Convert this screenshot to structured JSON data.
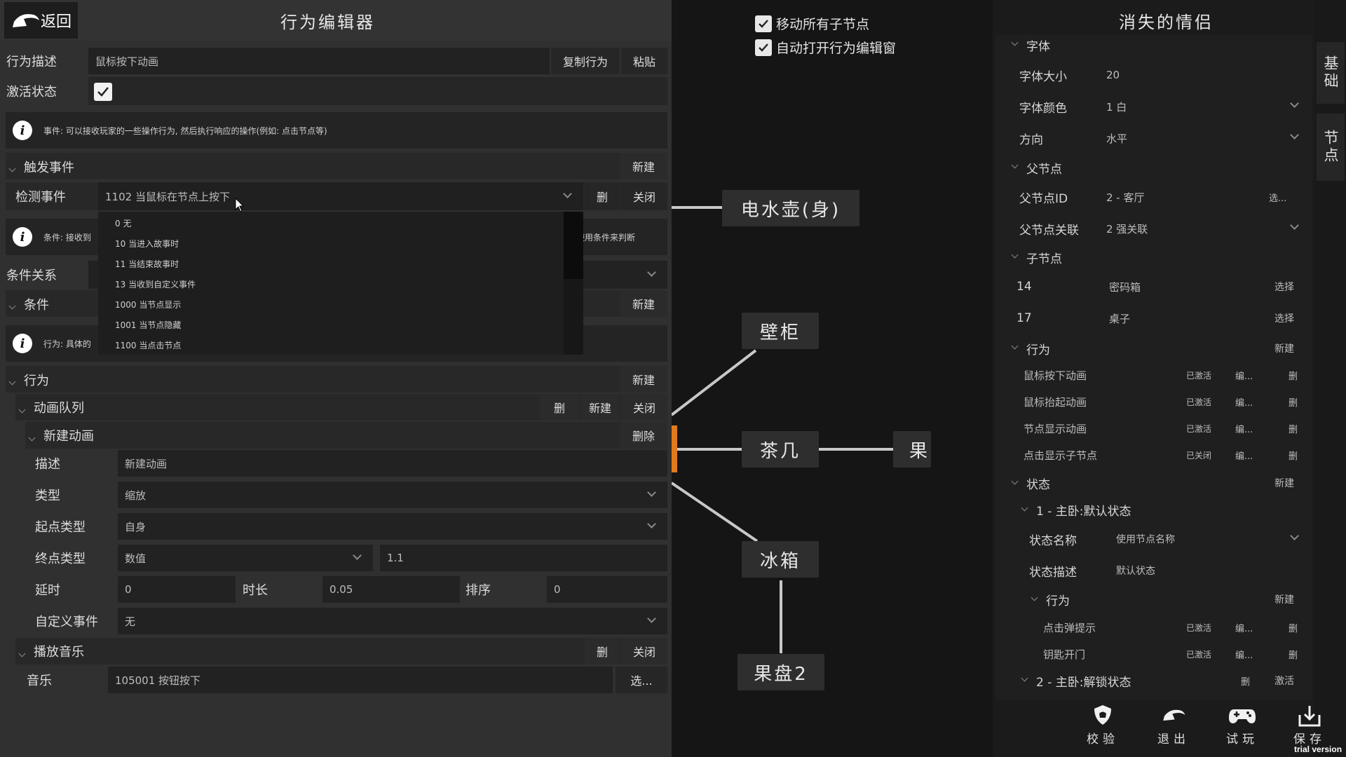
{
  "left": {
    "back_label": "返回",
    "title": "行为编辑器",
    "desc_label": "行为描述",
    "desc_value": "鼠标按下动画",
    "copy_label": "复制行为",
    "paste_label": "粘贴",
    "active_label": "激活状态",
    "event_info": "事件: 可以接收玩家的一些操作行为, 然后执行响应的操作(例如: 点击节点等)",
    "trigger_label": "触发事件",
    "new_label": "新建",
    "detect_label": "检测事件",
    "detect_value": "1102 当鼠标在节点上按下",
    "delete_short": "删",
    "close_label": "关闭",
    "cond_info_a": "条件: 接收到",
    "cond_info_b": "可使用条件来判断",
    "cond_rel_label": "条件关系",
    "cond_label": "条件",
    "action_info": "行为: 具体的",
    "action_label": "行为",
    "anim_queue_label": "动画队列",
    "new_anim_label": "新建动画",
    "delete_label": "删除",
    "d_desc_label": "描述",
    "d_desc_value": "新建动画",
    "type_label": "类型",
    "type_value": "缩放",
    "start_type_label": "起点类型",
    "start_type_value": "自身",
    "end_type_label": "终点类型",
    "end_type_value": "数值",
    "end_value": "1.1",
    "delay_label": "延时",
    "delay_value": "0",
    "duration_label": "时长",
    "duration_value": "0.05",
    "order_label": "排序",
    "order_value": "0",
    "custom_event_label": "自定义事件",
    "custom_event_value": "无",
    "play_music_label": "播放音乐",
    "music_label": "音乐",
    "music_value": "105001 按钮按下",
    "select_dots": "选...",
    "dropdown_items": [
      "0 无",
      "10 当进入故事时",
      "11 当结束故事时",
      "13 当收到自定义事件",
      "1000 当节点显示",
      "1001 当节点隐藏",
      "1100 当点击节点"
    ]
  },
  "graph": {
    "move_children": "移动所有子节点",
    "auto_open": "自动打开行为编辑窗",
    "nodes": {
      "kettle": "电水壶(身)",
      "cabinet": "壁柜",
      "tea_table": "茶几",
      "partial": "果",
      "fridge": "冰箱",
      "fruit_plate": "果盘2"
    }
  },
  "right": {
    "title": "消失的情侣",
    "font_section": "字体",
    "font_size_label": "字体大小",
    "font_size_value": "20",
    "font_color_label": "字体颜色",
    "font_color_value": "1 白",
    "direction_label": "方向",
    "direction_value": "水平",
    "parent_section": "父节点",
    "parent_id_label": "父节点ID",
    "parent_id_value": "2 - 客厅",
    "select_dots": "选...",
    "parent_rel_label": "父节点关联",
    "parent_rel_value": "2 强关联",
    "children_section": "子节点",
    "children": [
      {
        "id": "14",
        "name": "密码箱",
        "action": "选择"
      },
      {
        "id": "17",
        "name": "桌子",
        "action": "选择"
      }
    ],
    "behavior_section": "行为",
    "new_label": "新建",
    "edit_label": "编...",
    "delete_short": "删",
    "behaviors": [
      {
        "name": "鼠标按下动画",
        "status": "已激活"
      },
      {
        "name": "鼠标抬起动画",
        "status": "已激活"
      },
      {
        "name": "节点显示动画",
        "status": "已激活"
      },
      {
        "name": "点击显示子节点",
        "status": "已关闭"
      }
    ],
    "state_section": "状态",
    "state1_title": "1 - 主卧:默认状态",
    "state_name_label": "状态名称",
    "state_name_value": "使用节点名称",
    "state_desc_label": "状态描述",
    "state_desc_value": "默认状态",
    "sub_behavior_label": "行为",
    "state_behaviors": [
      {
        "name": "点击弹提示",
        "status": "已激活"
      },
      {
        "name": "钥匙开门",
        "status": "已激活"
      }
    ],
    "state2_title": "2 - 主卧:解锁状态",
    "activate_label": "激活"
  },
  "sidetabs": {
    "basic": "基础",
    "node": "节点"
  },
  "toolbar": {
    "verify": "校验",
    "exit": "退出",
    "try": "试玩",
    "save": "保存"
  },
  "watermark": "trial version"
}
